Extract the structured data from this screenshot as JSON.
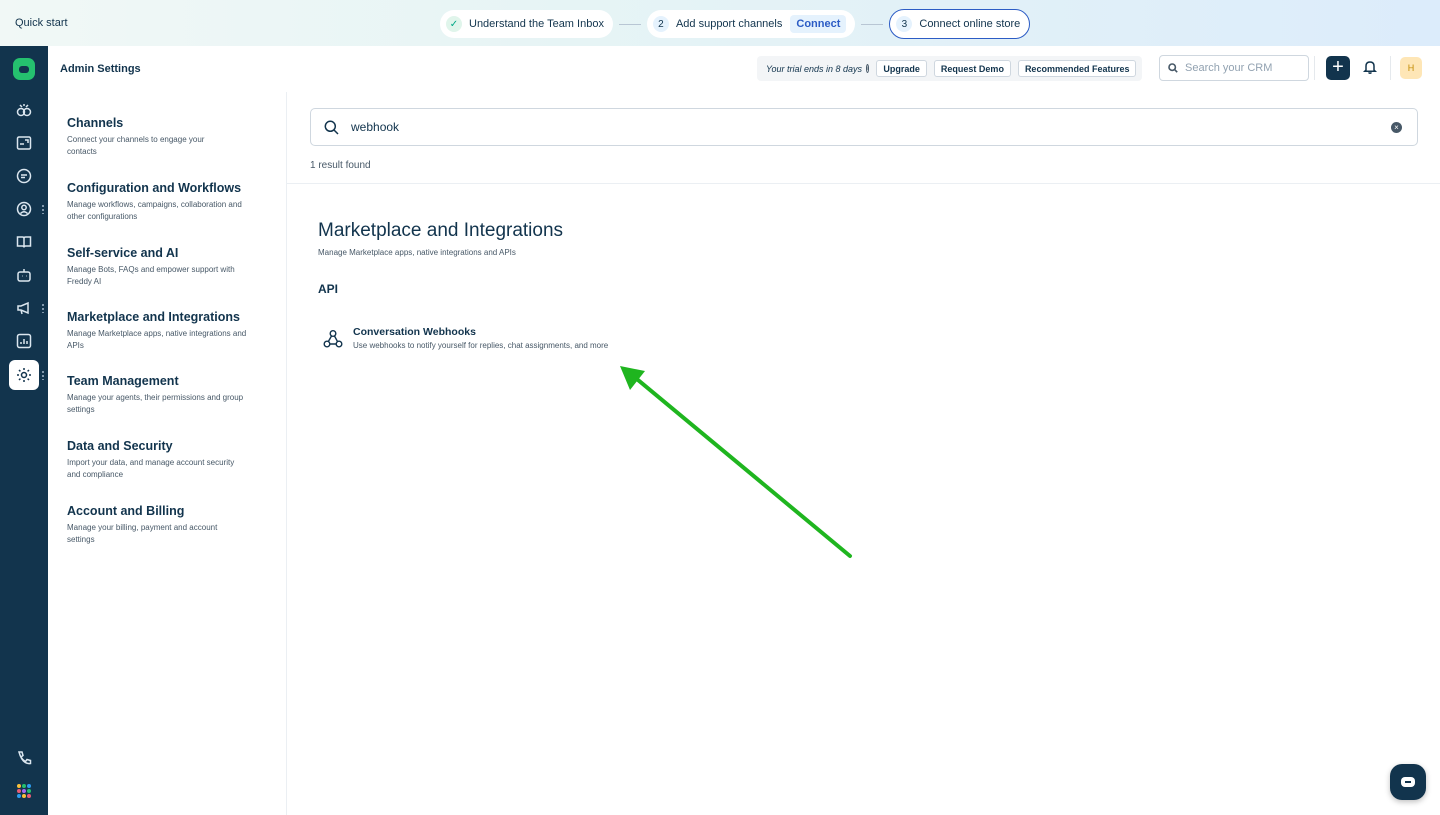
{
  "quickstart": {
    "title": "Quick start",
    "step1_label": "Understand the Team Inbox",
    "step2_num": "2",
    "step2_label": "Add support channels",
    "step2_action": "Connect",
    "step3_num": "3",
    "step3_label": "Connect online store"
  },
  "header": {
    "title": "Admin Settings",
    "trial_text": "Your trial ends in 8 days",
    "upgrade_label": "Upgrade",
    "request_demo_label": "Request Demo",
    "recommended_label": "Recommended Features",
    "search_placeholder": "Search your CRM",
    "avatar_initial": "H"
  },
  "rail": {
    "icons": [
      "logo-icon",
      "dashboard-icon",
      "inbox-icon",
      "conversations-icon",
      "contacts-icon",
      "knowledge-base-icon",
      "bot-icon",
      "campaigns-icon",
      "reports-icon",
      "settings-icon",
      "phone-icon",
      "apps-icon"
    ],
    "brand_color": "#25c16f",
    "bg_color": "#12344d"
  },
  "settings_nav": {
    "items": [
      {
        "title": "Channels",
        "desc": "Connect your channels to engage your contacts"
      },
      {
        "title": "Configuration and Workflows",
        "desc": "Manage workflows, campaigns, collaboration and other configurations"
      },
      {
        "title": "Self-service and AI",
        "desc": "Manage Bots, FAQs and empower support with Freddy AI"
      },
      {
        "title": "Marketplace and Integrations",
        "desc": "Manage Marketplace apps, native integrations and APIs"
      },
      {
        "title": "Team Management",
        "desc": "Manage your agents, their permissions and group settings"
      },
      {
        "title": "Data and Security",
        "desc": "Import your data, and manage account security and compliance"
      },
      {
        "title": "Account and Billing",
        "desc": "Manage your billing, payment and account settings"
      }
    ]
  },
  "main": {
    "search_value": "webhook",
    "result_count": "1 result found",
    "section_title": "Marketplace and Integrations",
    "section_desc": "Manage Marketplace apps, native integrations and APIs",
    "group_label": "API",
    "result": {
      "icon": "webhook-icon",
      "name": "Conversation Webhooks",
      "desc": "Use webhooks to notify yourself for replies, chat assignments, and more"
    }
  },
  "annotation": {
    "arrow_color": "#1fb51f"
  }
}
